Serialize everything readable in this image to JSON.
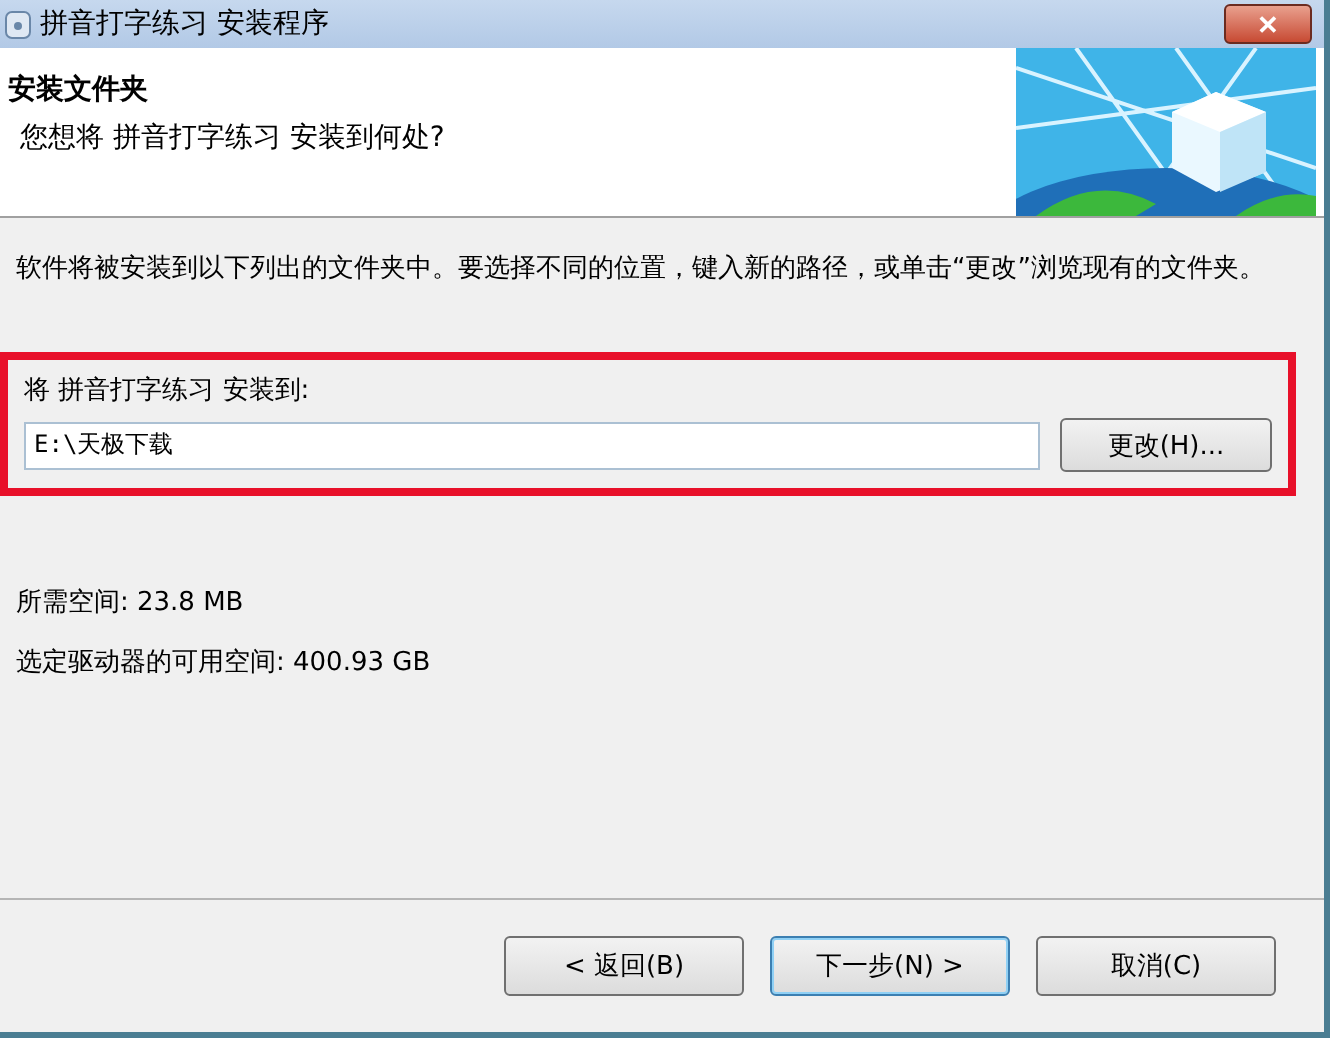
{
  "window": {
    "title": "拼音打字练习 安装程序",
    "close": "✕"
  },
  "header": {
    "title": "安装文件夹",
    "subtitle": "您想将 拼音打字练习 安装到何处?"
  },
  "description": "软件将被安装到以下列出的文件夹中。要选择不同的位置，键入新的路径，或单击“更改”浏览现有的文件夹。",
  "install_group": {
    "highlighted": true,
    "label": "将 拼音打字练习 安装到:",
    "path": "E:\\天极下载",
    "browse_button": "更改(H)..."
  },
  "space": [
    "所需空间: 23.8 MB",
    "选定驱动器的可用空间: 400.93 GB"
  ],
  "buttons": [
    {
      "label": "< 返回(B)",
      "default": false
    },
    {
      "label": "下一步(N) >",
      "default": true
    },
    {
      "label": "取消(C)",
      "default": false
    }
  ]
}
